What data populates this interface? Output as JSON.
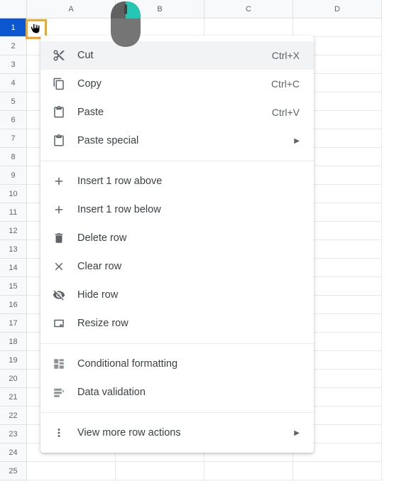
{
  "columns": [
    "A",
    "B",
    "C",
    "D"
  ],
  "visible_rows": 25,
  "selected_row": 1,
  "menu": {
    "cut": {
      "label": "Cut",
      "shortcut": "Ctrl+X"
    },
    "copy": {
      "label": "Copy",
      "shortcut": "Ctrl+C"
    },
    "paste": {
      "label": "Paste",
      "shortcut": "Ctrl+V"
    },
    "paste_special": {
      "label": "Paste special"
    },
    "insert_above": {
      "label": "Insert 1 row above"
    },
    "insert_below": {
      "label": "Insert 1 row below"
    },
    "delete_row": {
      "label": "Delete row"
    },
    "clear_row": {
      "label": "Clear row"
    },
    "hide_row": {
      "label": "Hide row"
    },
    "resize_row": {
      "label": "Resize row"
    },
    "conditional": {
      "label": "Conditional formatting"
    },
    "data_validation": {
      "label": "Data validation"
    },
    "more_actions": {
      "label": "View more row actions"
    }
  }
}
